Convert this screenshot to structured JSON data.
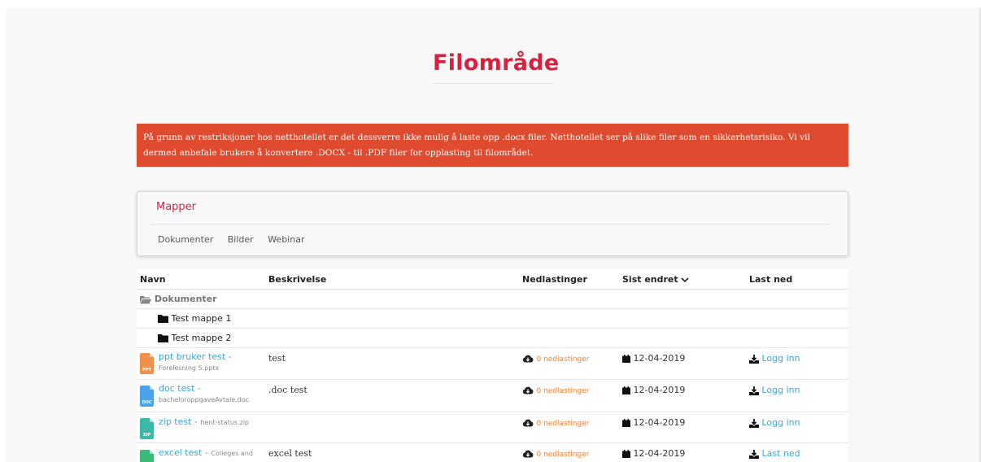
{
  "page": {
    "title": "Filområde"
  },
  "notice": {
    "text": "På grunn av restriksjoner hos netthotellet er det dessverre ikke mulig å laste opp .docx filer. Netthotellet ser på slike filer som en sikkerhetsrisiko. Vi vil dermed anbefale brukere å konvertere .DOCX - til .PDF filer for opplasting til filområdet."
  },
  "folders": {
    "title": "Mapper",
    "links": [
      "Dokumenter",
      "Bilder",
      "Webinar"
    ]
  },
  "table": {
    "headers": {
      "name": "Navn",
      "description": "Beskrivelse",
      "downloads": "Nedlastinger",
      "modified": "Sist endret",
      "download": "Last ned"
    },
    "section": {
      "label": "Dokumenter",
      "icon": "folder-open-icon"
    },
    "subfolders": [
      {
        "label": "Test mappe 1",
        "icon": "folder-icon"
      },
      {
        "label": "Test mappe 2",
        "icon": "folder-icon"
      }
    ],
    "files": [
      {
        "title": "ppt bruker test",
        "sep": " - ",
        "filename": "Forelesning 5.pptx",
        "type": "PPT",
        "color": "#f0914a",
        "description": "test",
        "downloads": "0 nedlastinger",
        "date": "12-04-2019",
        "action": "Logg inn"
      },
      {
        "title": "doc test",
        "sep": " - ",
        "filename": "bacheloroppgaveAvtale.doc",
        "type": "DOC",
        "color": "#4aa3e8",
        "description": ".doc test",
        "downloads": "0 nedlastinger",
        "date": "12-04-2019",
        "action": "Logg inn"
      },
      {
        "title": "zip test",
        "sep": " - ",
        "filename": "hent-status.zip",
        "type": "ZIP",
        "color": "#3bb8a6",
        "description": "",
        "downloads": "0 nedlastinger",
        "date": "12-04-2019",
        "action": "Logg inn"
      },
      {
        "title": "excel test",
        "sep": " - ",
        "filename": "Colleges and",
        "type": "XLS",
        "color": "#3cb878",
        "description": "excel test",
        "downloads": "0 nedlastinger",
        "date": "12-04-2019",
        "action": "Last ned"
      }
    ]
  },
  "colors": {
    "accent": "#d8213f",
    "notice_bg": "#de4b2f",
    "link": "#3ba7d7",
    "downloads": "#f0823a"
  }
}
